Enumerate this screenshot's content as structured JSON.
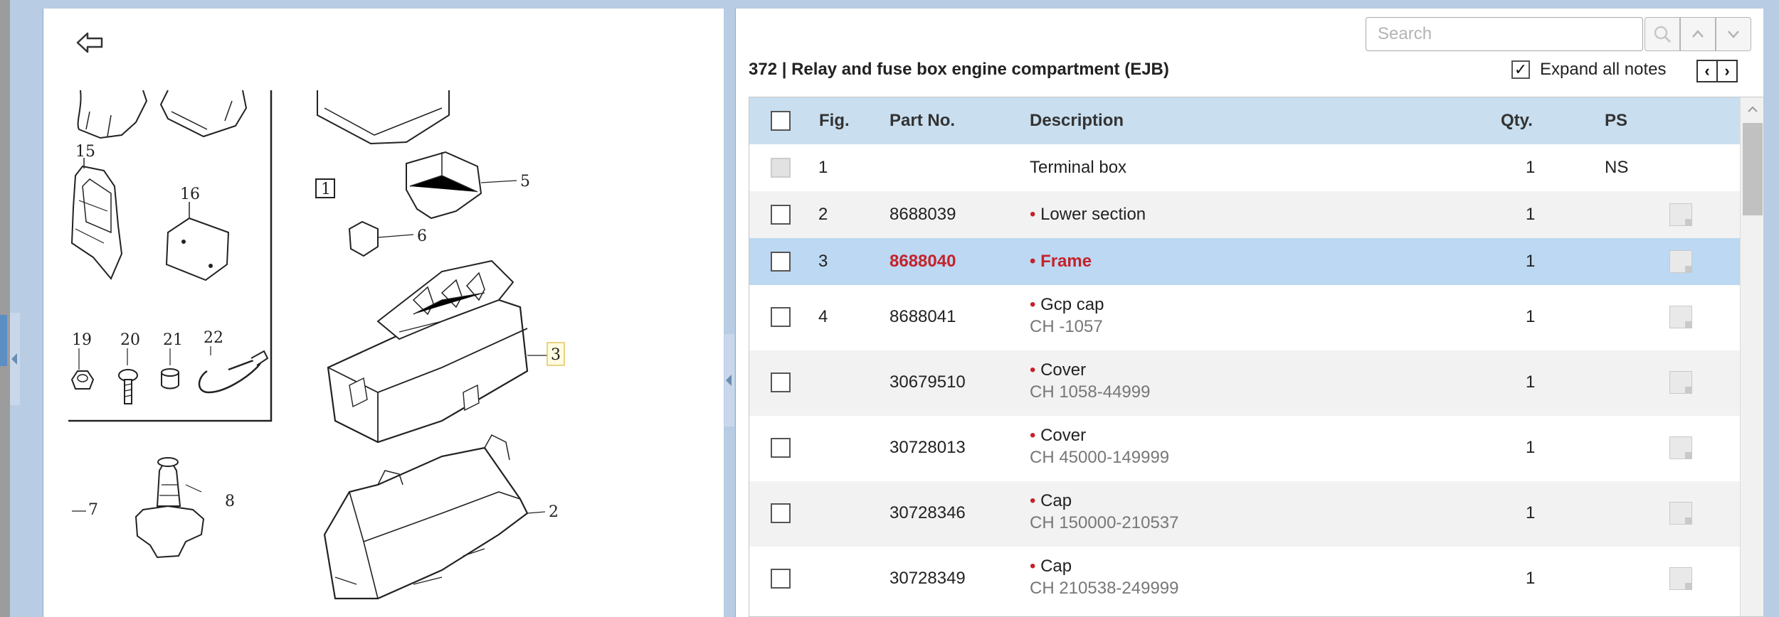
{
  "drawing": {
    "back_icon": "back-arrow-icon",
    "callouts": [
      "15",
      "16",
      "19",
      "20",
      "21",
      "22",
      "7",
      "8",
      "1",
      "5",
      "6",
      "3",
      "2"
    ]
  },
  "parts": {
    "search": {
      "placeholder": "Search",
      "value": ""
    },
    "buttons": {
      "search_icon": "magnifier-icon",
      "prev_icon": "chevron-up-icon",
      "next_icon": "chevron-down-icon"
    },
    "group_title": "372  |  Relay and fuse box engine compartment (EJB)",
    "expand_all_label": "Expand all notes",
    "expand_all_checked": true,
    "pager": {
      "prev": "‹",
      "next": "›"
    },
    "columns": {
      "fig": "Fig.",
      "part_no": "Part No.",
      "description": "Description",
      "qty": "Qty.",
      "ps": "PS"
    },
    "rows": [
      {
        "fig": "1",
        "part_no": "",
        "description": "Terminal box",
        "bullet": "",
        "sub": "",
        "qty": "1",
        "ps": "NS",
        "note": false,
        "checkbox_disabled": true,
        "selected": false
      },
      {
        "fig": "2",
        "part_no": "8688039",
        "description": "Lower section",
        "bullet": "•",
        "sub": "",
        "qty": "1",
        "ps": "",
        "note": true,
        "checkbox_disabled": false,
        "selected": false
      },
      {
        "fig": "3",
        "part_no": "8688040",
        "description": "Frame",
        "bullet": "•",
        "sub": "",
        "qty": "1",
        "ps": "",
        "note": true,
        "checkbox_disabled": false,
        "selected": true
      },
      {
        "fig": "4",
        "part_no": "8688041",
        "description": "Gcp cap",
        "bullet": "•",
        "sub": "CH -1057",
        "qty": "1",
        "ps": "",
        "note": true,
        "checkbox_disabled": false,
        "selected": false
      },
      {
        "fig": "",
        "part_no": "30679510",
        "description": "Cover",
        "bullet": "•",
        "sub": "CH 1058-44999",
        "qty": "1",
        "ps": "",
        "note": true,
        "checkbox_disabled": false,
        "selected": false
      },
      {
        "fig": "",
        "part_no": "30728013",
        "description": "Cover",
        "bullet": "•",
        "sub": "CH 45000-149999",
        "qty": "1",
        "ps": "",
        "note": true,
        "checkbox_disabled": false,
        "selected": false
      },
      {
        "fig": "",
        "part_no": "30728346",
        "description": "Cap",
        "bullet": "•",
        "sub": "CH 150000-210537",
        "qty": "1",
        "ps": "",
        "note": true,
        "checkbox_disabled": false,
        "selected": false
      },
      {
        "fig": "",
        "part_no": "30728349",
        "description": "Cap",
        "bullet": "•",
        "sub": "CH 210538-249999",
        "qty": "1",
        "ps": "",
        "note": true,
        "checkbox_disabled": false,
        "selected": false
      }
    ],
    "colors": {
      "selected_row": "#bcd8f2",
      "header": "#c9dff0",
      "part_red": "#c5222b",
      "frame_blue": "#b8cde3"
    }
  }
}
